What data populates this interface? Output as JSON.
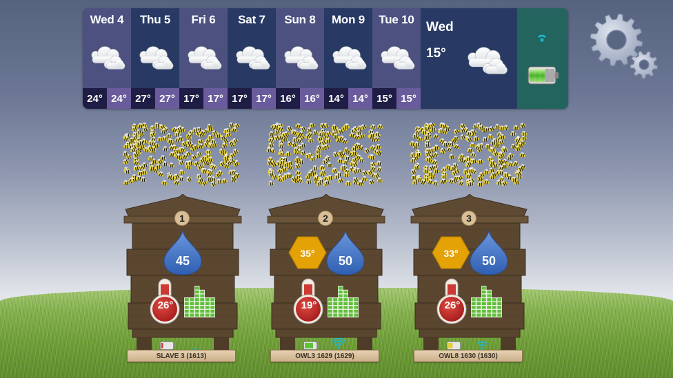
{
  "weather": {
    "forecast": [
      {
        "day": "Wed 4",
        "icon": "cloudy-icon",
        "low": "24°",
        "high": "24°"
      },
      {
        "day": "Thu 5",
        "icon": "cloudy-icon",
        "low": "27°",
        "high": "27°"
      },
      {
        "day": "Fri 6",
        "icon": "cloudy-icon",
        "low": "17°",
        "high": "17°"
      },
      {
        "day": "Sat 7",
        "icon": "cloudy-icon",
        "low": "17°",
        "high": "17°"
      },
      {
        "day": "Sun 8",
        "icon": "cloudy-icon",
        "low": "16°",
        "high": "16°"
      },
      {
        "day": "Mon 9",
        "icon": "cloudy-icon",
        "low": "14°",
        "high": "14°"
      },
      {
        "day": "Tue 10",
        "icon": "cloudy-icon",
        "low": "15°",
        "high": "15°"
      }
    ],
    "current": {
      "day": "Wed",
      "temp": "15°",
      "icon": "cloudy-icon"
    },
    "status": {
      "wifi": "wifi-icon",
      "battery_level": 0.6
    }
  },
  "settings": {
    "icon": "gears-icon"
  },
  "hives": [
    {
      "number": "1",
      "humidity": "45",
      "outer_temp": null,
      "inner_temp": "26°",
      "label": "SLAVE 3 (1613)",
      "battery_level": 0.15,
      "battery_color": "#d9302c",
      "wifi_strength": 0.1
    },
    {
      "number": "2",
      "humidity": "50",
      "outer_temp": "35°",
      "inner_temp": "19°",
      "label": "OWL3 1629 (1629)",
      "battery_level": 0.75,
      "battery_color": "#5fc43a",
      "wifi_strength": 1.0
    },
    {
      "number": "3",
      "humidity": "50",
      "outer_temp": "33°",
      "inner_temp": "26°",
      "label": "OWL8 1630 (1630)",
      "battery_level": 0.4,
      "battery_color": "#e2cf3a",
      "wifi_strength": 0.6
    }
  ],
  "colors": {
    "humidity": "#3d6fc1",
    "outer_temp": "#e2a000",
    "inner_temp": "#c3282b",
    "bars": "#5fbf3b",
    "wifi": "#1fb4c9",
    "wood": "#5b4630"
  }
}
